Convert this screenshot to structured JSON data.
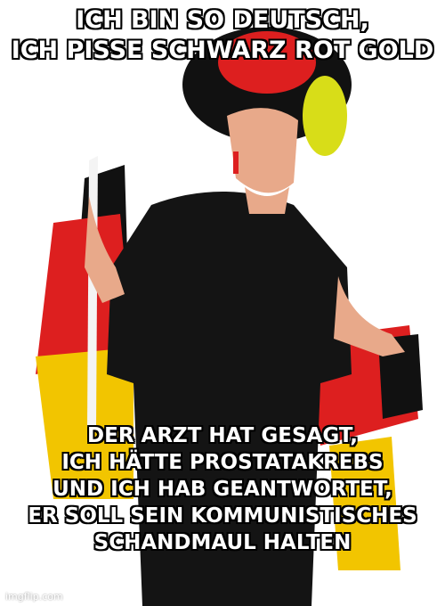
{
  "top_caption": {
    "lines": [
      "ICH  BIN SO DEUTSCH,",
      "ICH PISSE SCHWARZ ROT GOLD"
    ]
  },
  "bottom_caption": {
    "lines": [
      "DER ARZT HAT GESAGT,",
      "ICH HÄTTE PROSTATAKREBS",
      "UND ICH HAB GEANTWORTET,",
      "ER SOLL SEIN KOMMUNISTISCHES",
      "SCHANDMAUL HALTEN"
    ]
  },
  "watermark": {
    "text": "imgflip.com"
  },
  "colors": {
    "flag_black": "#111111",
    "flag_red": "#dd1f1f",
    "flag_gold": "#f2c500",
    "shirt": "#141414",
    "skin": "#e8a98a"
  }
}
